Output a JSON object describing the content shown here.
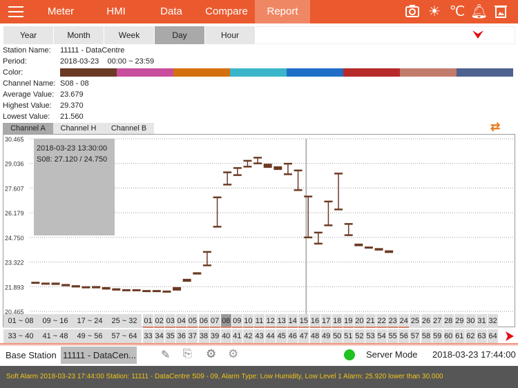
{
  "topbar": {
    "menu": [
      "Meter",
      "HMI",
      "Data",
      "Compare",
      "Report"
    ],
    "selected": "Report",
    "icons": [
      "camera-icon",
      "brightness-icon",
      "celsius-icon",
      "bell-icon",
      "trash-image-icon"
    ],
    "celsius": "℃",
    "color": "#ea5a2e"
  },
  "period_tabs": {
    "items": [
      "Year",
      "Month",
      "Week",
      "Day",
      "Hour"
    ],
    "selected": "Day"
  },
  "info": {
    "station_label": "Station Name:",
    "station": "11111 - DataCentre",
    "period_label": "Period:",
    "period": "2018-03-23    00:00 ~ 23:59",
    "color_label": "Color:",
    "colors": [
      "#6b3a24",
      "#c84e9e",
      "#d4700f",
      "#3bb5c9",
      "#1e6ec8",
      "#b82a2a",
      "#c27c6b",
      "#4e6290"
    ],
    "channel_label": "Channel Name:",
    "channel": "S08 - 08",
    "avg_label": "Average Value:",
    "avg": "23.679",
    "high_label": "Highest Value:",
    "high": "29.370",
    "low_label": "Lowest Value:",
    "low": "21.560"
  },
  "channel_tabs": {
    "items": [
      "Channel A",
      "Channel H",
      "Channel B"
    ],
    "selected": "Channel A"
  },
  "chart_data": {
    "type": "candlestick-range",
    "ylim": [
      20.465,
      30.465
    ],
    "yticks": [
      "30.465",
      "29.036",
      "27.607",
      "26.179",
      "24.750",
      "23.322",
      "21.893",
      "20.465"
    ],
    "x_slots": 48,
    "ranges": [
      [
        22.18,
        22.1
      ],
      [
        22.13,
        22.05
      ],
      [
        22.13,
        22.0
      ],
      [
        22.05,
        21.92
      ],
      [
        21.98,
        21.85
      ],
      [
        21.92,
        21.84
      ],
      [
        21.93,
        21.8
      ],
      [
        21.87,
        21.73
      ],
      [
        21.8,
        21.67
      ],
      [
        21.75,
        21.67
      ],
      [
        21.75,
        21.67
      ],
      [
        21.7,
        21.6
      ],
      [
        21.7,
        21.6
      ],
      [
        21.67,
        21.56
      ],
      [
        21.87,
        21.67
      ],
      [
        22.35,
        22.18
      ],
      [
        22.73,
        22.6
      ],
      [
        23.91,
        23.13
      ],
      [
        27.07,
        25.37
      ],
      [
        28.52,
        27.81
      ],
      [
        28.77,
        28.36
      ],
      [
        29.19,
        28.85
      ],
      [
        29.37,
        29.04
      ],
      [
        29.02,
        28.78
      ],
      [
        28.87,
        28.66
      ],
      [
        29.02,
        28.41
      ],
      [
        28.63,
        27.49
      ],
      [
        27.12,
        24.75
      ],
      [
        25.03,
        24.39
      ],
      [
        26.83,
        25.45
      ],
      [
        28.45,
        26.37
      ],
      [
        25.53,
        24.88
      ],
      [
        24.39,
        24.24
      ],
      [
        24.22,
        24.1
      ],
      [
        24.13,
        23.99
      ],
      [
        24.0,
        23.85
      ]
    ],
    "cursor_index": 27,
    "tooltip": {
      "time": "2018-03-23 13:30:00",
      "value": "S08: 27.120 / 24.750"
    },
    "series_color": "#6b3a24"
  },
  "channel_selector": {
    "groups_row1": [
      "01 ~ 08",
      "09 ~ 16",
      "17 ~ 24",
      "25 ~ 32"
    ],
    "groups_row2": [
      "33 ~ 40",
      "41 ~ 48",
      "49 ~ 56",
      "57 ~ 64"
    ],
    "selected_channel": "08",
    "active_count": 24
  },
  "bottom": {
    "base_label": "Base Station",
    "station": "11111 - DataCen...",
    "mode": "Server Mode",
    "status_color": "#1fc21f",
    "datetime": "2018-03-23 17:44:00"
  },
  "alarm": "Soft Alarm 2018-03-23 17:44:00 Station: 11111 - DataCentre S09 - 09, Alarm Type: Low Humidity, Low Level 1 Alarm: 25.920 lower than 30.000"
}
